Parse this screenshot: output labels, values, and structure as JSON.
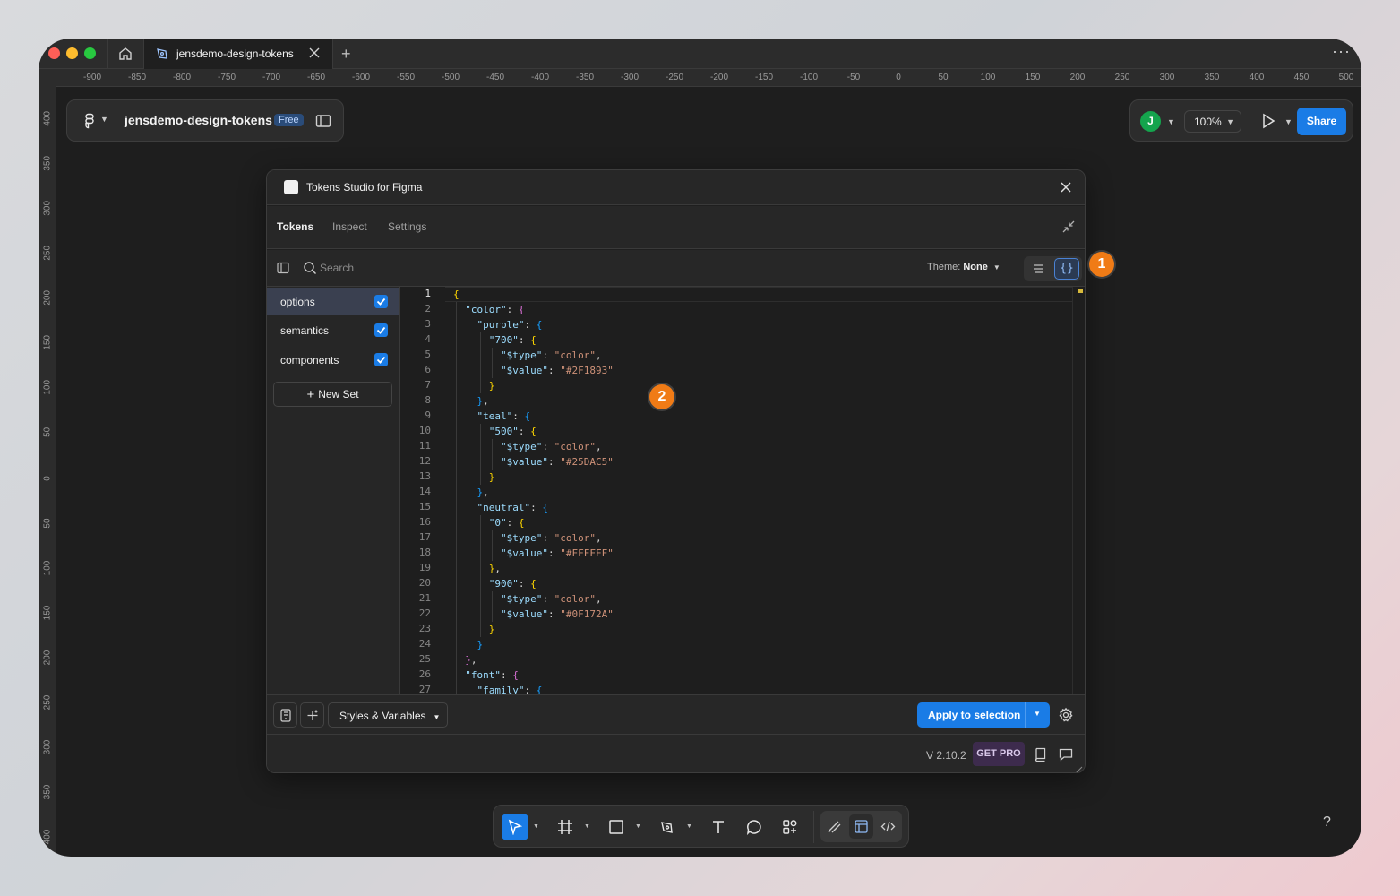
{
  "browser": {
    "tab_title": "jensdemo-design-tokens",
    "new_tab_symbol": "+",
    "more_symbol": "···"
  },
  "rulers": {
    "horizontal": [
      "-900",
      "-850",
      "-800",
      "-750",
      "-700",
      "-650",
      "-600",
      "-550",
      "-500",
      "-450",
      "-400",
      "-350",
      "-300",
      "-250",
      "-200",
      "-150",
      "-100",
      "-50",
      "0",
      "50",
      "100",
      "150",
      "200",
      "250",
      "300",
      "350",
      "400",
      "450",
      "500"
    ],
    "vertical": [
      "-400",
      "-350",
      "-300",
      "-250",
      "-200",
      "-150",
      "-100",
      "-50",
      "0",
      "50",
      "100",
      "150",
      "200",
      "250",
      "300",
      "350",
      "400"
    ]
  },
  "file_card": {
    "title": "jensdemo-design-tokens",
    "plan_badge": "Free"
  },
  "right_card": {
    "avatar_initial": "J",
    "zoom": "100%",
    "share_label": "Share"
  },
  "plugin": {
    "title": "Tokens Studio for Figma",
    "tabs": [
      {
        "label": "Tokens",
        "active": true
      },
      {
        "label": "Inspect",
        "active": false
      },
      {
        "label": "Settings",
        "active": false
      }
    ],
    "search_placeholder": "Search",
    "theme_label": "Theme:",
    "theme_value": "None",
    "json_toggle_glyph": "{}",
    "sets": [
      {
        "name": "options",
        "checked": true,
        "active": true
      },
      {
        "name": "semantics",
        "checked": true,
        "active": false
      },
      {
        "name": "components",
        "checked": true,
        "active": false
      }
    ],
    "new_set_label": "New Set",
    "code_lines": [
      "{",
      "  \"color\": {",
      "    \"purple\": {",
      "      \"700\": {",
      "        \"$type\": \"color\",",
      "        \"$value\": \"#2F1893\"",
      "      }",
      "    },",
      "    \"teal\": {",
      "      \"500\": {",
      "        \"$type\": \"color\",",
      "        \"$value\": \"#25DAC5\"",
      "      }",
      "    },",
      "    \"neutral\": {",
      "      \"0\": {",
      "        \"$type\": \"color\",",
      "        \"$value\": \"#FFFFFF\"",
      "      },",
      "      \"900\": {",
      "        \"$type\": \"color\",",
      "        \"$value\": \"#0F172A\"",
      "      }",
      "    }",
      "  },",
      "  \"font\": {",
      "    \"family\": {"
    ],
    "styles_select": "Styles & Variables",
    "apply_label": "Apply to selection",
    "version": "V 2.10.2",
    "get_pro": "GET PRO"
  },
  "callouts": [
    "1",
    "2"
  ],
  "help_symbol": "?",
  "colors": {
    "accent": "#1a7ce6",
    "callout": "#f07b16",
    "avatar": "#14a44d"
  }
}
